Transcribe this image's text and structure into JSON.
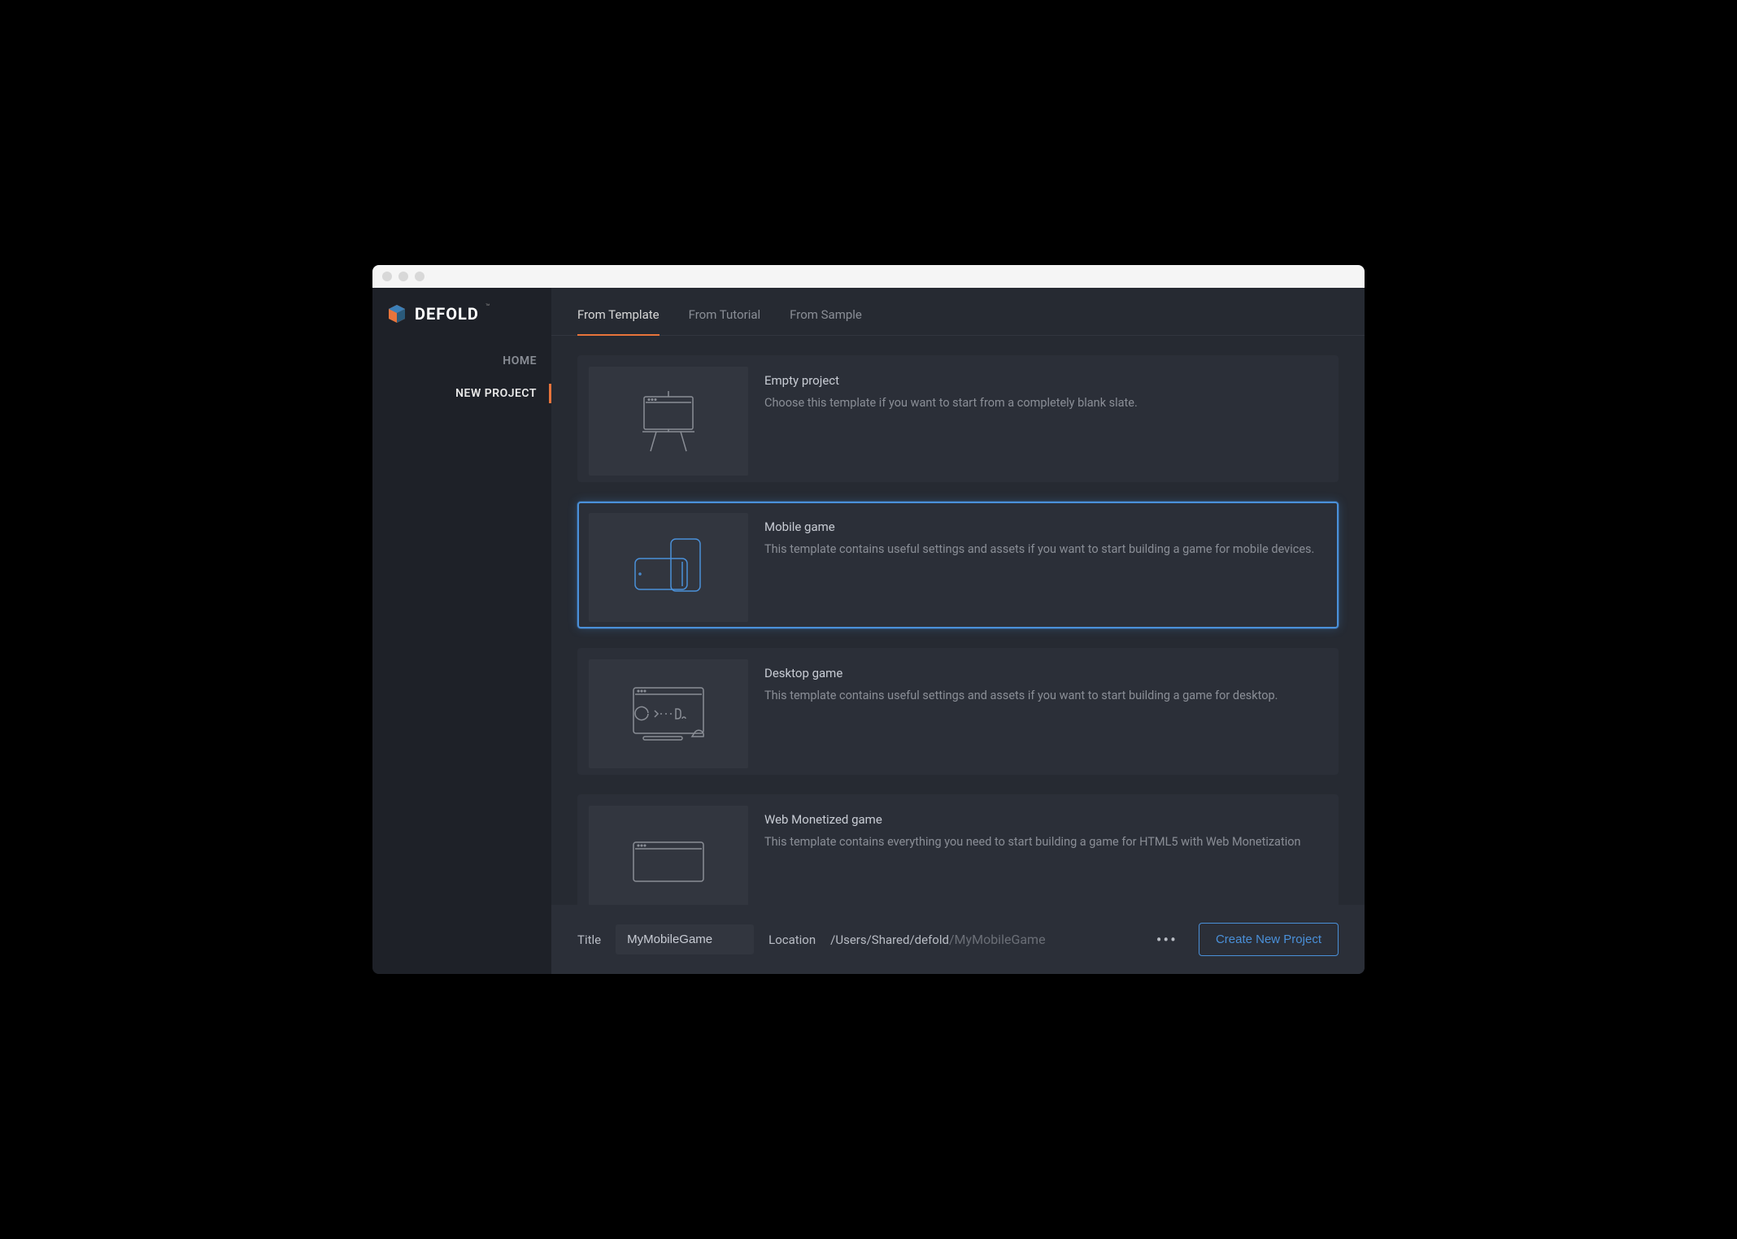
{
  "app_name": "DEFOLD",
  "sidebar": {
    "items": [
      {
        "label": "HOME",
        "active": false
      },
      {
        "label": "NEW PROJECT",
        "active": true
      }
    ]
  },
  "tabs": [
    {
      "label": "From Template",
      "active": true
    },
    {
      "label": "From Tutorial",
      "active": false
    },
    {
      "label": "From Sample",
      "active": false
    }
  ],
  "templates": [
    {
      "title": "Empty project",
      "description": "Choose this template if you want to start from a completely blank slate.",
      "icon": "easel-icon",
      "selected": false
    },
    {
      "title": "Mobile game",
      "description": "This template contains useful settings and assets if you want to start building a game for mobile devices.",
      "icon": "mobile-icon",
      "selected": true
    },
    {
      "title": "Desktop game",
      "description": "This template contains useful settings and assets if you want to start building a game for desktop.",
      "icon": "desktop-icon",
      "selected": false
    },
    {
      "title": "Web Monetized game",
      "description": "This template contains everything you need to start building a game for HTML5 with Web Monetization",
      "icon": "web-icon",
      "selected": false
    }
  ],
  "footer": {
    "title_label": "Title",
    "title_value": "MyMobileGame",
    "location_label": "Location",
    "location_path": "/Users/Shared/defold",
    "location_suffix": "/MyMobileGame",
    "more_label": "•••",
    "create_label": "Create New Project"
  }
}
